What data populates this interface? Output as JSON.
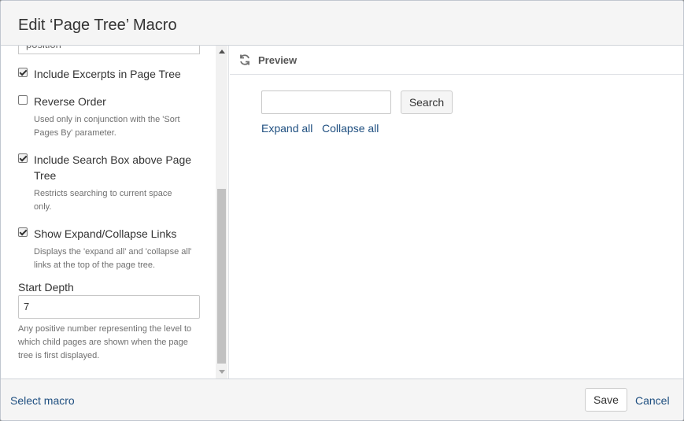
{
  "dialog": {
    "title": "Edit ‘Page Tree’ Macro"
  },
  "options": {
    "top_input_value": "position",
    "include_excerpts": {
      "label": "Include Excerpts in Page Tree",
      "checked": true
    },
    "reverse_order": {
      "label": "Reverse Order",
      "checked": false,
      "help": "Used only in conjunction with the 'Sort Pages By' parameter."
    },
    "include_search": {
      "label": "Include Search Box above Page Tree",
      "checked": true,
      "help": "Restricts searching to current space only."
    },
    "show_expand": {
      "label": "Show Expand/Collapse Links",
      "checked": true,
      "help": "Displays the 'expand all' and 'collapse all' links at the top of the page tree."
    },
    "start_depth": {
      "label": "Start Depth",
      "value": "7",
      "help": "Any positive number representing the level to which child pages are shown when the page tree is first displayed."
    }
  },
  "preview": {
    "title": "Preview",
    "search_button": "Search",
    "expand_all": "Expand all",
    "collapse_all": "Collapse all"
  },
  "footer": {
    "select_macro": "Select macro",
    "save": "Save",
    "cancel": "Cancel"
  },
  "colors": {
    "link": "#205081",
    "help_text": "#707070"
  }
}
